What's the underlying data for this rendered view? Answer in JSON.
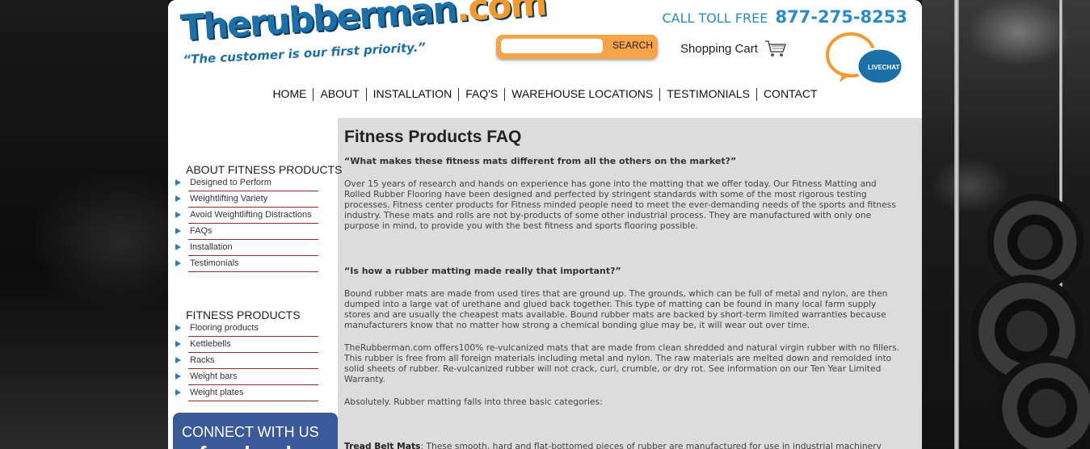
{
  "header": {
    "logo_name_a": "The",
    "logo_name_b": "rubberman",
    "logo_name_c": ".com",
    "logo_tagline": "“The customer is our first priority.”",
    "phone_label": "CALL TOLL FREE",
    "phone_number": "877-275-8253",
    "search_button": "SEARCH",
    "search_value": "",
    "cart_label": "Shopping Cart",
    "livechat_label": "LIVECHAT"
  },
  "nav": [
    "HOME",
    "ABOUT",
    "INSTALLATION",
    "FAQ'S",
    "WAREHOUSE LOCATIONS",
    "TESTIMONIALS",
    "CONTACT"
  ],
  "sidebar": {
    "section1_title": "ABOUT FITNESS PRODUCTS",
    "section1_items": [
      "Designed to Perform",
      "Weightlifting Variety",
      "Avoid Weightlifting Distractions",
      "FAQs",
      "Installation",
      "Testimonials"
    ],
    "section2_title": "FITNESS PRODUCTS",
    "section2_items": [
      "Flooring products",
      "Kettlebells",
      "Racks",
      "Weight bars",
      "Weight plates"
    ],
    "connect_label": "CONNECT WITH US",
    "facebook_label": "facebook"
  },
  "main": {
    "title": "Fitness Products FAQ",
    "q1": "“What makes these fitness mats different from all the others on the market?”",
    "p1": "Over 15 years of research and hands on experience has gone into the matting that we offer today. Our Fitness Matting and Rolled Rubber Flooring have been designed and perfected by stringent standards with some of the most rigorous testing processes.  Fitness center products for Fitness minded people need to meet the ever-demanding needs of the sports and fitness industry. These mats and rolls are not by-products of some other industrial process. They are manufactured with only one purpose in mind, to provide you with the best fitness and sports flooring possible.",
    "q2": "“Is how a rubber matting made really that important?”",
    "p2": "Bound rubber mats are made from used tires that are ground up. The grounds, which can be full of metal and nylon, are then dumped into a large vat of urethane and glued back together. This type of matting can be found in many local farm supply stores and are usually the cheapest mats available. Bound rubber mats are backed by short-term limited warranties because manufacturers know that no matter how strong a chemical bonding glue may be, it will wear out over time.",
    "p3": "TheRubberman.com offers100% re-vulcanized mats that are made from clean shredded and natural virgin rubber with no fillers. This rubber is free from all foreign materials including metal and nylon. The raw materials are melted down and remolded into solid sheets of rubber. Re-vulcanized rubber will not crack, curl, crumble, or dry rot.   See information on our Ten Year Limited Warranty.",
    "p4": "Absolutely.  Rubber matting falls into three basic categories:",
    "p5_bold": "Tread Belt Mats",
    "p5": ": These smooth, hard and flat-bottomed pieces of rubber are manufactured for use in industrial machinery"
  },
  "colors": {
    "accent_blue": "#2b8bc6",
    "search_orange": "#f6a44a",
    "content_gray": "#dcdcdc",
    "side_divider": "#8a2f22",
    "facebook_blue": "#3b5998"
  }
}
